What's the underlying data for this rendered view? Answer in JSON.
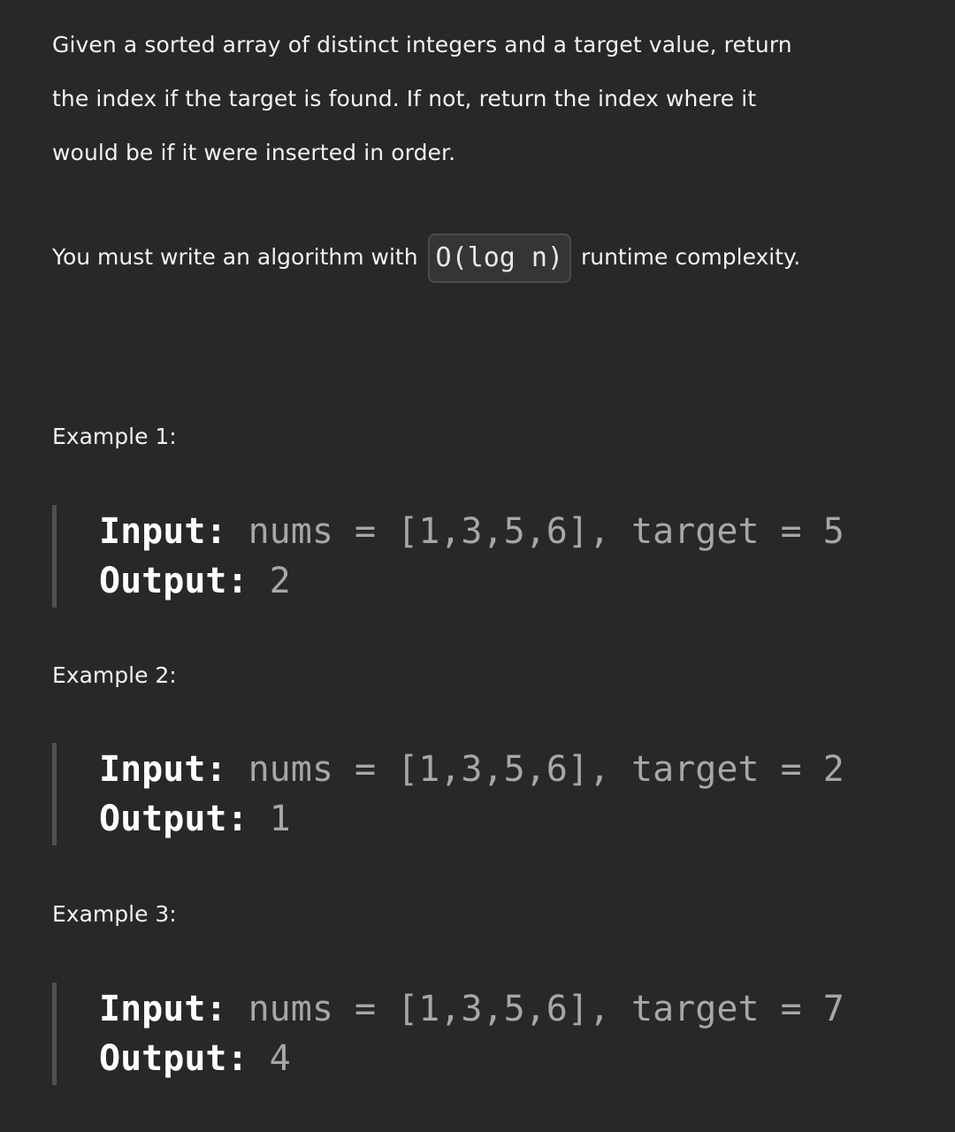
{
  "description": {
    "line1": "Given a sorted array of distinct integers and a target value, return",
    "line2": "the index if the target is found. If not, return the index where it",
    "line3": "would be if it were inserted in order.",
    "complexity_prefix": "You must write an algorithm with",
    "complexity_code": "O(log n)",
    "complexity_suffix": "runtime complexity."
  },
  "examples": [
    {
      "heading": "Example 1:",
      "input_label": "Input:",
      "input_value": " nums = [1,3,5,6], target = 5",
      "output_label": "Output:",
      "output_value": " 2"
    },
    {
      "heading": "Example 2:",
      "input_label": "Input:",
      "input_value": " nums = [1,3,5,6], target = 2",
      "output_label": "Output:",
      "output_value": " 1"
    },
    {
      "heading": "Example 3:",
      "input_label": "Input:",
      "input_value": " nums = [1,3,5,6], target = 7",
      "output_label": "Output:",
      "output_value": " 4"
    }
  ],
  "colors": {
    "background": "#282828",
    "text": "#f2f2f2",
    "code_value": "#a7a7a7",
    "blockquote_border": "#505050"
  }
}
